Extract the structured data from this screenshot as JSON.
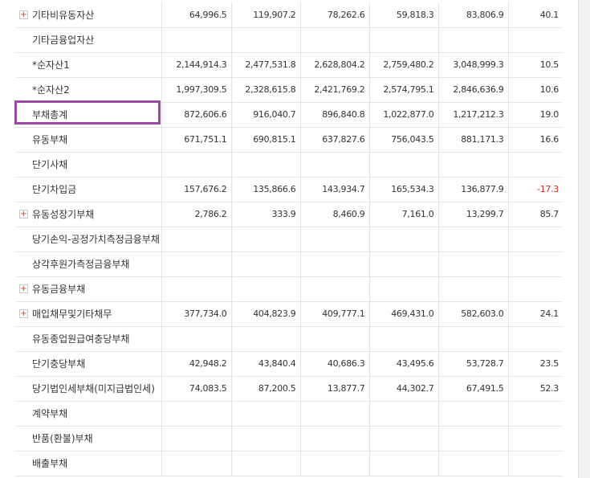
{
  "accent": "#9b4aa3",
  "negative_color": "#e1251b",
  "rows": [
    {
      "label": "기타비유동자산",
      "expandable": true,
      "values": [
        "64,996.5",
        "119,907.2",
        "78,262.6",
        "59,818.3",
        "83,806.9",
        "40.1"
      ]
    },
    {
      "label": "기타금융업자산",
      "expandable": false,
      "values": [
        "",
        "",
        "",
        "",
        "",
        ""
      ]
    },
    {
      "label": "*순자산1",
      "expandable": false,
      "values": [
        "2,144,914.3",
        "2,477,531.8",
        "2,628,804.2",
        "2,759,480.2",
        "3,048,999.3",
        "10.5"
      ]
    },
    {
      "label": "*순자산2",
      "expandable": false,
      "values": [
        "1,997,309.5",
        "2,328,615.8",
        "2,421,769.2",
        "2,574,795.1",
        "2,846,636.9",
        "10.6"
      ]
    },
    {
      "label": "부채총계",
      "expandable": false,
      "values": [
        "872,606.6",
        "916,040.7",
        "896,840.8",
        "1,022,877.0",
        "1,217,212.3",
        "19.0"
      ]
    },
    {
      "label": "유동부채",
      "expandable": false,
      "values": [
        "671,751.1",
        "690,815.1",
        "637,827.6",
        "756,043.5",
        "881,171.3",
        "16.6"
      ]
    },
    {
      "label": "단기사채",
      "expandable": false,
      "values": [
        "",
        "",
        "",
        "",
        "",
        ""
      ]
    },
    {
      "label": "단기차입금",
      "expandable": false,
      "values": [
        "157,676.2",
        "135,866.6",
        "143,934.7",
        "165,534.3",
        "136,877.9",
        "-17.3"
      ]
    },
    {
      "label": "유동성장기부채",
      "expandable": true,
      "values": [
        "2,786.2",
        "333.9",
        "8,460.9",
        "7,161.0",
        "13,299.7",
        "85.7"
      ]
    },
    {
      "label": "당기손익-공정가치측정금융부채",
      "expandable": false,
      "values": [
        "",
        "",
        "",
        "",
        "",
        ""
      ]
    },
    {
      "label": "상각후원가측정금융부채",
      "expandable": false,
      "values": [
        "",
        "",
        "",
        "",
        "",
        ""
      ]
    },
    {
      "label": "유동금융부채",
      "expandable": true,
      "values": [
        "",
        "",
        "",
        "",
        "",
        ""
      ]
    },
    {
      "label": "매입채무및기타채무",
      "expandable": true,
      "values": [
        "377,734.0",
        "404,823.9",
        "409,777.1",
        "469,431.0",
        "582,603.0",
        "24.1"
      ]
    },
    {
      "label": "유동종업원급여충당부채",
      "expandable": false,
      "values": [
        "",
        "",
        "",
        "",
        "",
        ""
      ]
    },
    {
      "label": "단기충당부채",
      "expandable": false,
      "values": [
        "42,948.2",
        "43,840.4",
        "40,686.3",
        "43,495.6",
        "53,728.7",
        "23.5"
      ]
    },
    {
      "label": "당기법인세부채(미지급법인세)",
      "expandable": false,
      "values": [
        "74,083.5",
        "87,200.5",
        "13,877.7",
        "44,302.7",
        "67,491.5",
        "52.3"
      ]
    },
    {
      "label": "계약부채",
      "expandable": false,
      "values": [
        "",
        "",
        "",
        "",
        "",
        ""
      ]
    },
    {
      "label": "반품(환불)부채",
      "expandable": false,
      "values": [
        "",
        "",
        "",
        "",
        "",
        ""
      ]
    },
    {
      "label": "배출부채",
      "expandable": false,
      "values": [
        "",
        "",
        "",
        "",
        "",
        ""
      ]
    }
  ]
}
